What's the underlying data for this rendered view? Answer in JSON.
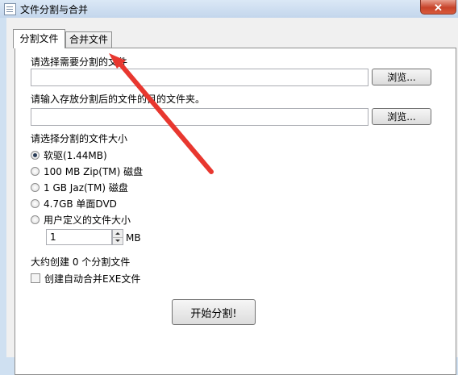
{
  "window": {
    "title": "文件分割与合并",
    "close_symbol": "✕"
  },
  "tabs": [
    {
      "label": "分割文件",
      "active": true
    },
    {
      "label": "合并文件",
      "active": false
    }
  ],
  "split": {
    "choose_file_label": "请选择需要分割的文件",
    "file_path_value": "",
    "browse_label": "浏览...",
    "folder_label": "请输入存放分割后的文件的目的文件夹。",
    "folder_path_value": "",
    "size_label": "请选择分割的文件大小",
    "sizes": [
      {
        "label": "软驱(1.44MB)",
        "checked": true
      },
      {
        "label": "100 MB Zip(TM) 磁盘",
        "checked": false
      },
      {
        "label": "1 GB Jaz(TM) 磁盘",
        "checked": false
      },
      {
        "label": "4.7GB 单面DVD",
        "checked": false
      },
      {
        "label": "用户定义的文件大小",
        "checked": false
      }
    ],
    "custom_size_value": "1",
    "custom_unit": "MB",
    "estimate_text": "大约创建 0 个分割文件",
    "exe_checkbox_label": "创建自动合并EXE文件",
    "exe_checked": false,
    "start_label": "开始分割!"
  },
  "annotation": {
    "arrow_color": "#e8372f"
  },
  "colors": {
    "title_bg": "#cfe0f1",
    "close_red": "#c7432a"
  }
}
